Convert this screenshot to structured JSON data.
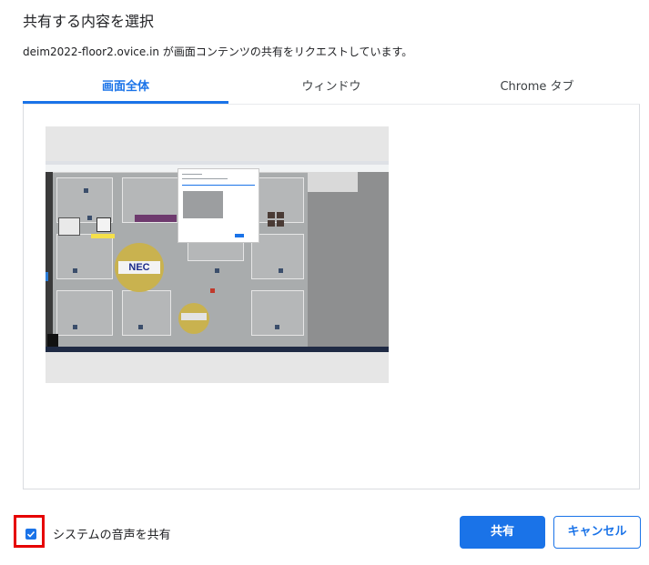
{
  "dialog": {
    "title": "共有する内容を選択",
    "subtitle": "deim2022-floor2.ovice.in が画面コンテンツの共有をリクエストしています。"
  },
  "tabs": [
    {
      "label": "画面全体",
      "active": true
    },
    {
      "label": "ウィンドウ",
      "active": false
    },
    {
      "label": "Chrome タブ",
      "active": false
    }
  ],
  "preview": {
    "logo_text": "NEC"
  },
  "footer": {
    "system_audio_label": "システムの音声を共有",
    "system_audio_checked": true,
    "share_button": "共有",
    "cancel_button": "キャンセル"
  },
  "colors": {
    "accent": "#1a73e8",
    "highlight_box": "#e60000"
  }
}
